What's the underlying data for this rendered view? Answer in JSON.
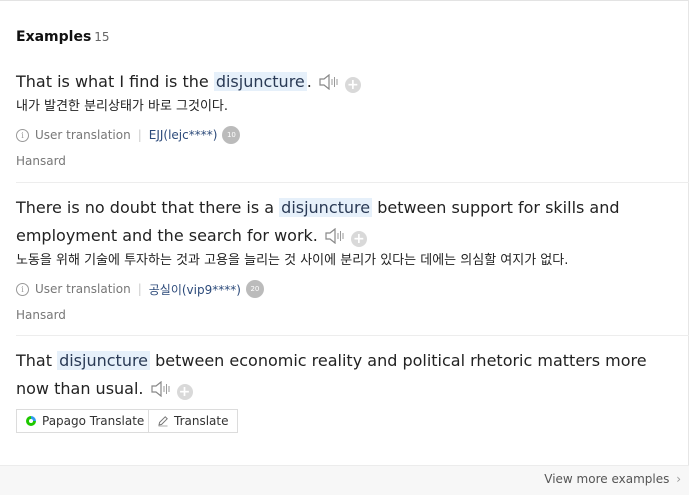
{
  "header": {
    "title": "Examples",
    "count": "15"
  },
  "examples": [
    {
      "pre": "That is what I find is the ",
      "term": "disjuncture",
      "post": ".",
      "translation": "내가 발견한 분리상태가 바로 그것이다.",
      "type_label": "User translation",
      "user": "EJJ(lejc****)",
      "badge": "10",
      "source": "Hansard"
    },
    {
      "pre": "There is no doubt that there is a ",
      "term": "disjuncture",
      "post": " between support for skills and employment and the search for work.",
      "translation": "노동을 위해 기술에 투자하는 것과 고용을 늘리는 것 사이에 분리가 있다는 데에는 의심할 여지가 없다.",
      "type_label": "User translation",
      "user": "공실이(vip9****)",
      "badge": "20",
      "source": "Hansard"
    },
    {
      "pre": "That ",
      "term": "disjuncture",
      "post": " between economic reality and political rhetoric matters more now than usual."
    }
  ],
  "buttons": {
    "papago": "Papago Translate",
    "translate": "Translate"
  },
  "footer": {
    "more": "View more examples"
  },
  "icons": {
    "sound": "speaker-icon",
    "add": "plus-icon",
    "info": "info-icon",
    "papago": "papago-logo-icon",
    "pencil": "pencil-icon",
    "chevron": "chevron-right-icon"
  },
  "colors": {
    "highlight": "#e6f0fa",
    "user_link": "#2c4a7a",
    "badge": "#bbbbbb"
  }
}
